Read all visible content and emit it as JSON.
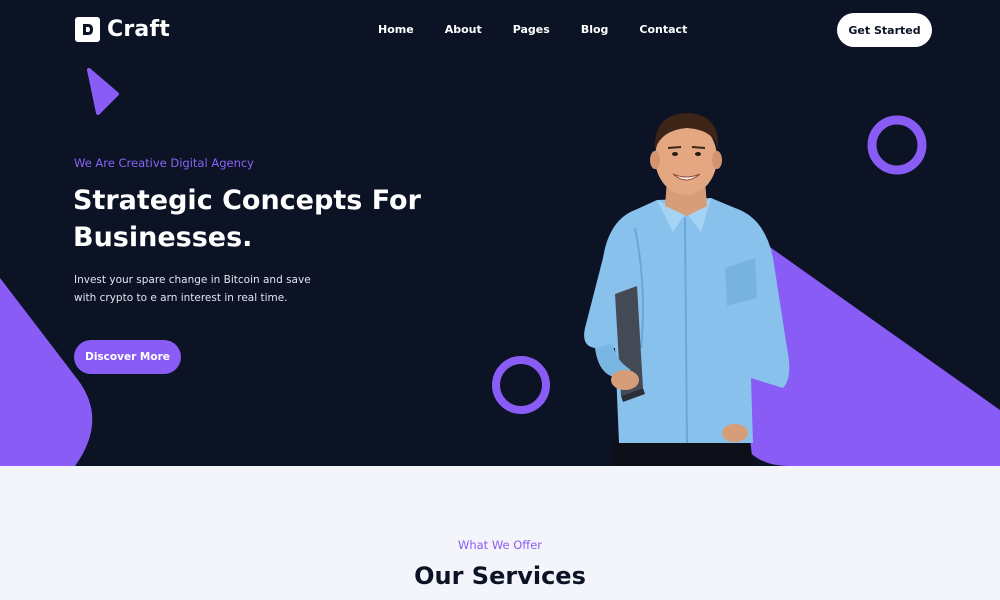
{
  "brand": {
    "name": "Craft"
  },
  "nav": {
    "items": [
      {
        "label": "Home"
      },
      {
        "label": "About"
      },
      {
        "label": "Pages"
      },
      {
        "label": "Blog"
      },
      {
        "label": "Contact"
      }
    ],
    "cta_label": "Get Started"
  },
  "hero": {
    "tagline": "We Are Creative Digital Agency",
    "headline": "Strategic Concepts For Businesses.",
    "description": "Invest your spare change in Bitcoin and save with crypto to e arn interest in real time.",
    "button_label": "Discover More"
  },
  "services": {
    "subtitle": "What We Offer",
    "title": "Our Services"
  },
  "colors": {
    "hero_bg": "#0b1325",
    "accent": "#8a5cf6",
    "page_bg": "#f3f5fa"
  },
  "icons": [
    "logo-icon",
    "triangle-decoration",
    "ring-decoration"
  ]
}
